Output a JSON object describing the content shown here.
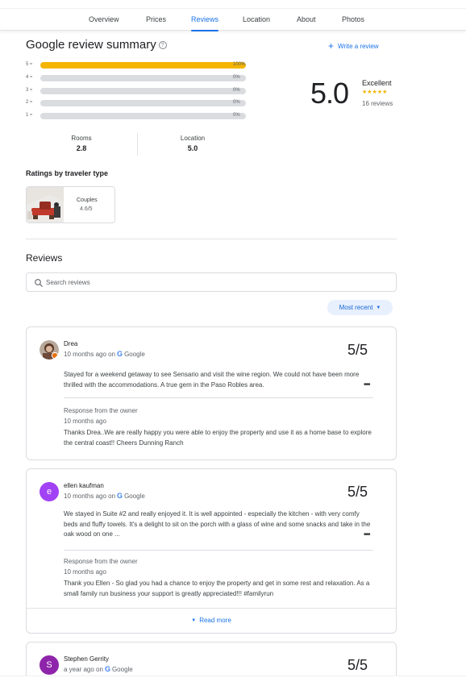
{
  "tabs": [
    "Overview",
    "Prices",
    "Reviews",
    "Location",
    "About",
    "Photos"
  ],
  "summary": {
    "title": "Google review summary",
    "help_icon": "?",
    "write_review": "Write a review",
    "bars": [
      {
        "label": "5",
        "percent": 100,
        "percent_text": "100%"
      },
      {
        "label": "4",
        "percent": 0,
        "percent_text": "0%"
      },
      {
        "label": "3",
        "percent": 0,
        "percent_text": "0%"
      },
      {
        "label": "2",
        "percent": 0,
        "percent_text": "0%"
      },
      {
        "label": "1",
        "percent": 0,
        "percent_text": "0%"
      }
    ],
    "score": "5.0",
    "rating_word": "Excellent",
    "stars": "★★★★★",
    "review_count": "16 reviews",
    "categories": [
      {
        "name": "Rooms",
        "value": "2.8"
      },
      {
        "name": "Location",
        "value": "5.0"
      }
    ]
  },
  "traveler": {
    "heading": "Ratings by traveler type",
    "type": "Couples",
    "score": "4.6/5"
  },
  "reviews_section": {
    "heading": "Reviews",
    "search_placeholder": "Search reviews",
    "sort_label": "Most recent"
  },
  "colors": {
    "accent": "#1a73e8",
    "star": "#f4b400",
    "avatar_ellen": "#a142f4",
    "avatar_stephen": "#8e24aa"
  },
  "reviews": [
    {
      "name": "Drea",
      "time": "10 months ago on",
      "source": "Google",
      "score": "5/5",
      "text": "Stayed for a weekend getaway to see Sensario and visit the wine region. We could not have been more thrilled with the accommodations. A true gem in the Paso Robles area.",
      "more": "•••",
      "owner_label": "Response from the owner",
      "owner_time": "10 months ago",
      "owner_text": "Thanks Drea..We are really happy you were able to enjoy the property and use it as a home base to explore the central coast!! Cheers Dunning Ranch"
    },
    {
      "name": "ellen kaufman",
      "initial": "e",
      "time": "10 months ago on",
      "source": "Google",
      "score": "5/5",
      "text": "We stayed in Suite #2 and really enjoyed it. It is well appointed - especially the kitchen - with very comfy beds and fluffy towels. It's a delight to sit on the porch with a glass of wine and some snacks and take in the oak wood on one ...",
      "more": "•••",
      "owner_label": "Response from the owner",
      "owner_time": "10 months ago",
      "owner_text": "Thank you Ellen - So glad you had a chance to enjoy the property and get in some rest and relaxation. As a small family run business your support is greatly appreciated!!! #familyrun",
      "read_more": "Read more"
    },
    {
      "name": "Stephen Gerrity",
      "initial": "S",
      "time": "a year ago on",
      "source": "Google",
      "score": "5/5"
    }
  ]
}
